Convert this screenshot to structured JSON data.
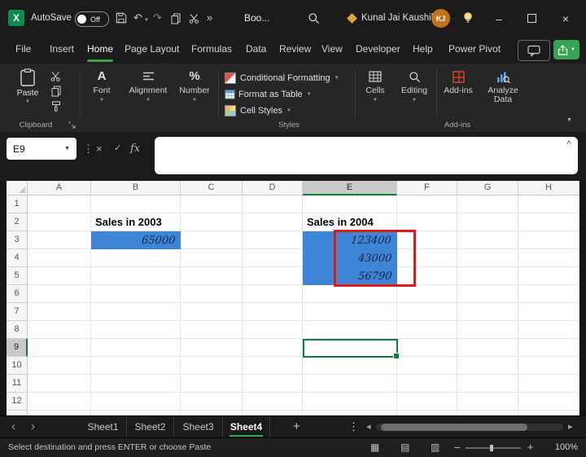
{
  "titlebar": {
    "autosave_label": "AutoSave",
    "autosave_state": "Off",
    "workbook_title": "Boo...",
    "user_name": "Kunal Jai Kaushik",
    "user_initials": "KJ"
  },
  "menubar": {
    "tabs": [
      "File",
      "Insert",
      "Home",
      "Page Layout",
      "Formulas",
      "Data",
      "Review",
      "View",
      "Developer",
      "Help",
      "Power Pivot"
    ],
    "active_tab": "Home"
  },
  "ribbon": {
    "paste": "Paste",
    "font": "Font",
    "alignment": "Alignment",
    "number": "Number",
    "conditional_formatting": "Conditional Formatting",
    "format_as_table": "Format as Table",
    "cell_styles": "Cell Styles",
    "cells": "Cells",
    "editing": "Editing",
    "addins": "Add-ins",
    "analyze_data": "Analyze Data",
    "groups": {
      "clipboard": "Clipboard",
      "styles": "Styles",
      "addins": "Add-ins"
    }
  },
  "formula_bar": {
    "name_box": "E9",
    "fx": "fx",
    "value": ""
  },
  "grid": {
    "col_headers": [
      "A",
      "B",
      "C",
      "D",
      "E",
      "F",
      "G",
      "H"
    ],
    "row_headers": [
      "1",
      "2",
      "3",
      "4",
      "5",
      "6",
      "7",
      "8",
      "9",
      "10",
      "11",
      "12"
    ],
    "selected_cell": "E9",
    "cells": [
      {
        "ref": "B2",
        "value": "Sales in 2003"
      },
      {
        "ref": "B3",
        "value": "65000"
      },
      {
        "ref": "E2",
        "value": "Sales in 2004"
      },
      {
        "ref": "E3",
        "value": "123400"
      },
      {
        "ref": "E4",
        "value": "43000"
      },
      {
        "ref": "E5",
        "value": "56790"
      }
    ],
    "fill_color": "#3E85D6",
    "annotation_color": "#E01A1A",
    "selection_color": "#107C41"
  },
  "sheet_bar": {
    "tabs": [
      "Sheet1",
      "Sheet2",
      "Sheet3",
      "Sheet4"
    ],
    "active_tab": "Sheet4"
  },
  "status_bar": {
    "message": "Select destination and press ENTER or choose Paste",
    "zoom": "100%"
  },
  "icons": {
    "excel_logo": "X",
    "undo": "↶",
    "redo": "↷",
    "overflow": "»",
    "chevron_down": "▼",
    "chevron_up": "˄",
    "more_vertical": "⋮",
    "cancel": "×",
    "check": "✓",
    "minimize": "–",
    "close": "×",
    "nav_left": "‹",
    "nav_right": "›",
    "scroll_left": "◂",
    "scroll_right": "▸",
    "plus": "+",
    "minus": "–",
    "percent": "%",
    "font_letter": "A",
    "view_normal": "▦",
    "view_layout": "▤",
    "view_break": "▥"
  }
}
